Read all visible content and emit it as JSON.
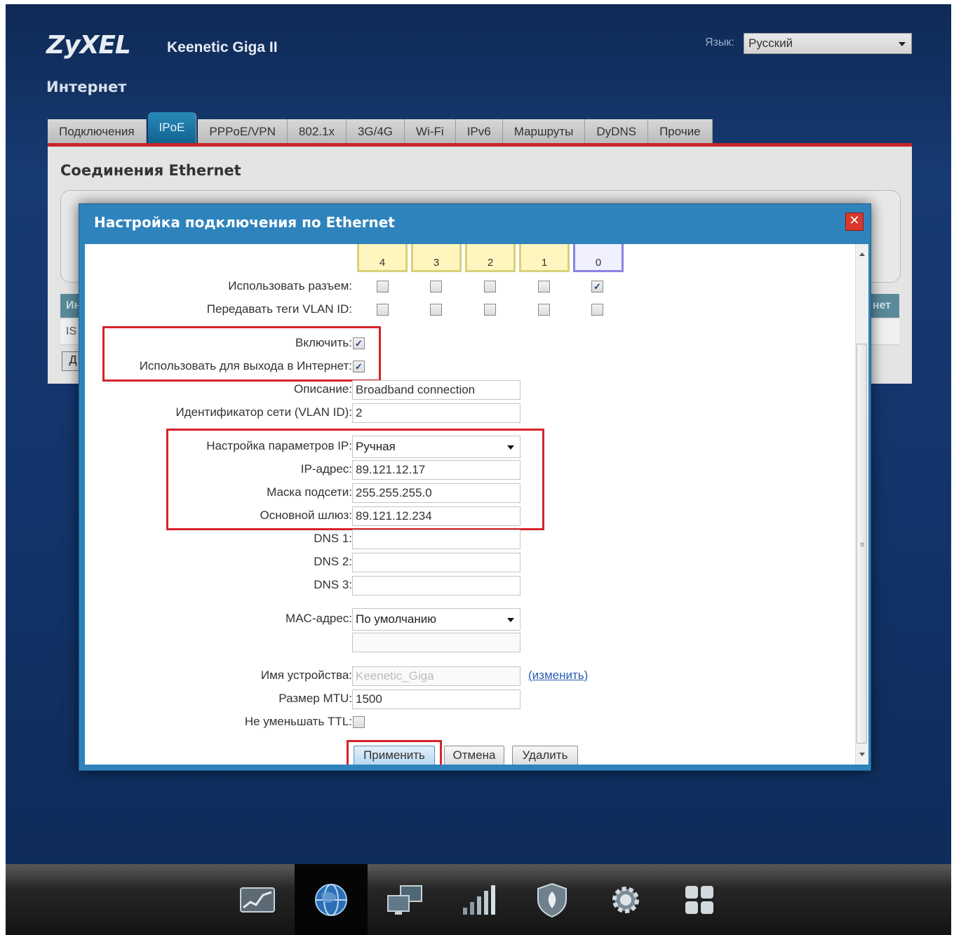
{
  "header": {
    "logo": "ZyXEL",
    "model": "Keenetic Giga II",
    "section": "Интернет",
    "lang_label": "Язык:",
    "lang_value": "Русский"
  },
  "tabs": [
    {
      "label": "Подключения",
      "active": false
    },
    {
      "label": "IPoE",
      "active": true
    },
    {
      "label": "PPPoE/VPN",
      "active": false
    },
    {
      "label": "802.1x",
      "active": false
    },
    {
      "label": "3G/4G",
      "active": false
    },
    {
      "label": "Wi-Fi",
      "active": false
    },
    {
      "label": "IPv6",
      "active": false
    },
    {
      "label": "Маршруты",
      "active": false
    },
    {
      "label": "DyDNS",
      "active": false
    },
    {
      "label": "Прочие",
      "active": false
    }
  ],
  "panel": {
    "title": "Соединения Ethernet",
    "strip_left": "Ин",
    "strip_right": "нет",
    "row_text": "IS",
    "button_text": "Д"
  },
  "dialog": {
    "title": "Настройка подключения по Ethernet",
    "close_glyph": "✕",
    "ports": [
      {
        "label": "4",
        "use": false,
        "vlan_tag": false,
        "selected": false
      },
      {
        "label": "3",
        "use": false,
        "vlan_tag": false,
        "selected": false
      },
      {
        "label": "2",
        "use": false,
        "vlan_tag": false,
        "selected": false
      },
      {
        "label": "1",
        "use": false,
        "vlan_tag": false,
        "selected": false
      },
      {
        "label": "0",
        "use": true,
        "vlan_tag": false,
        "selected": true
      }
    ],
    "labels": {
      "use_port": "Использовать разъем:",
      "vlan_tags": "Передавать теги VLAN ID:",
      "enable": "Включить:",
      "use_internet": "Использовать для выхода в Интернет:",
      "description": "Описание:",
      "vlan_id": "Идентификатор сети (VLAN ID):",
      "ip_config": "Настройка параметров IP:",
      "ip_address": "IP-адрес:",
      "subnet_mask": "Маска подсети:",
      "gateway": "Основной шлюз:",
      "dns1": "DNS 1:",
      "dns2": "DNS 2:",
      "dns3": "DNS 3:",
      "mac": "MAC-адрес:",
      "device_name": "Имя устройства:",
      "mtu": "Размер MTU:",
      "no_ttl": "Не уменьшать TTL:"
    },
    "values": {
      "enable": true,
      "use_internet": true,
      "description": "Broadband connection",
      "vlan_id": "2",
      "ip_config": "Ручная",
      "ip_address": "89.121.12.17",
      "subnet_mask": "255.255.255.0",
      "gateway": "89.121.12.234",
      "dns1": "",
      "dns2": "",
      "dns3": "",
      "mac": "По умолчанию",
      "mac_extra": "",
      "device_name": "Keenetic_Giga",
      "mtu": "1500",
      "no_ttl": false
    },
    "change_link": "(изменить)",
    "buttons": {
      "apply": "Применить",
      "cancel": "Отмена",
      "delete": "Удалить"
    },
    "check_glyph": "✓"
  },
  "footer": {
    "icons": [
      {
        "name": "monitor-chart-icon",
        "active": false
      },
      {
        "name": "globe-internet-icon",
        "active": true
      },
      {
        "name": "computers-network-icon",
        "active": false
      },
      {
        "name": "wifi-signal-bars-icon",
        "active": false
      },
      {
        "name": "shield-security-icon",
        "active": false
      },
      {
        "name": "gear-settings-icon",
        "active": false
      },
      {
        "name": "apps-grid-icon",
        "active": false
      }
    ]
  },
  "colors": {
    "accent_red": "#c8262a",
    "tab_active": "#1a74a4",
    "dialog_blue": "#2f83bd",
    "highlight_red": "#d6232b"
  }
}
